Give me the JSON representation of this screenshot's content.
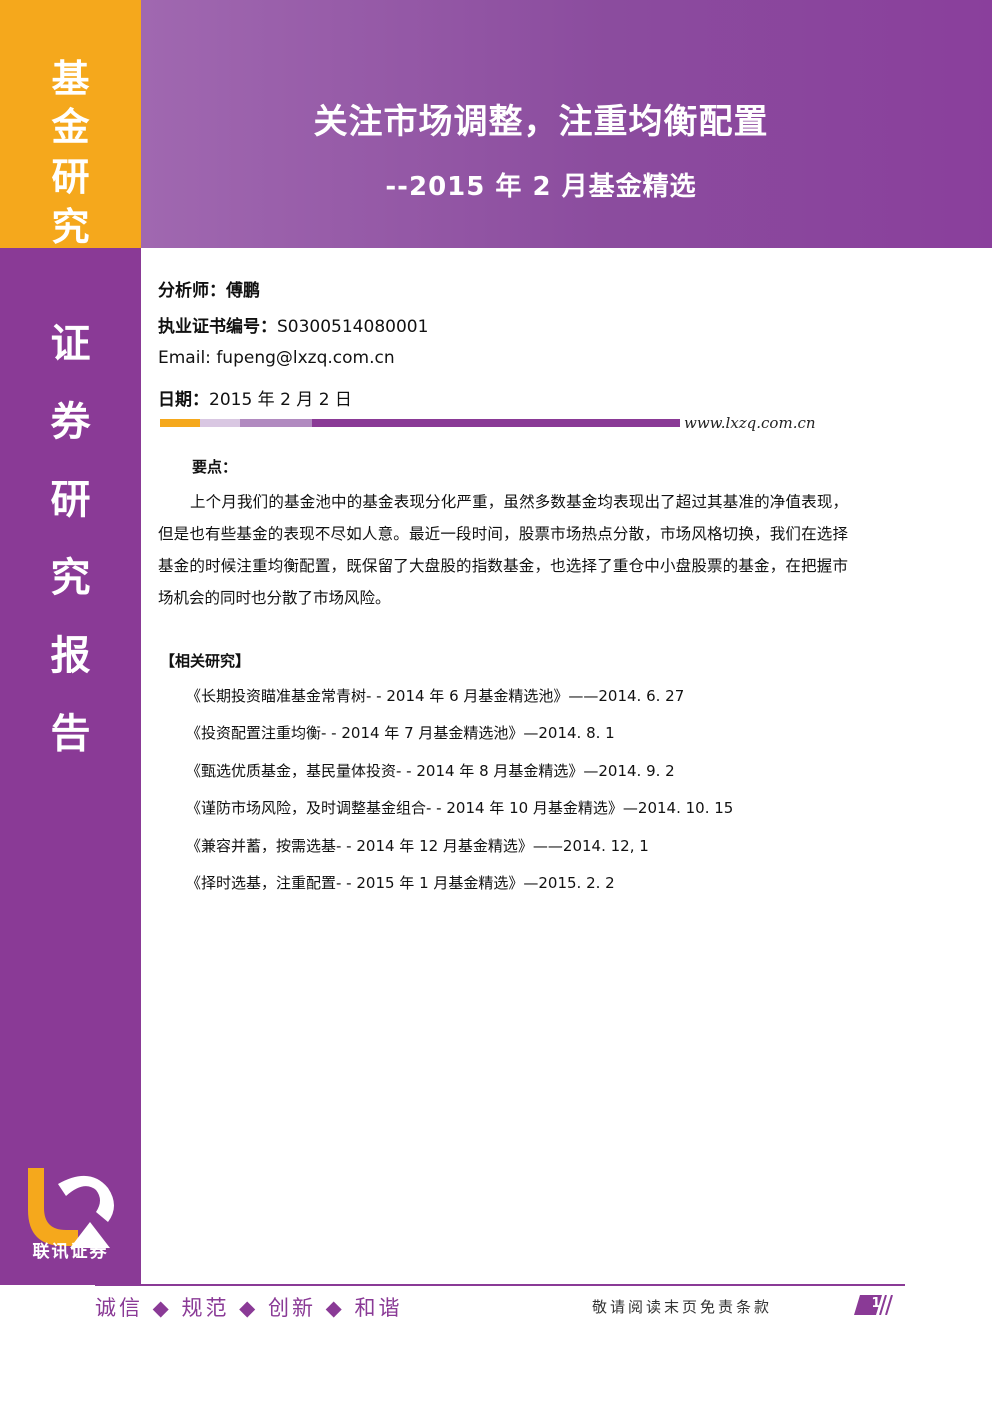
{
  "sidebar": {
    "category_chars": [
      "基",
      "金",
      "研",
      "究"
    ],
    "report_type_chars": [
      "证",
      "券",
      "研",
      "究",
      "报",
      "告"
    ],
    "logo_text": "联讯证券"
  },
  "header": {
    "title": "关注市场调整，注重均衡配置",
    "subtitle": "--2015 年 2 月基金精选"
  },
  "info": {
    "analyst_label": "分析师：",
    "analyst_name": "傅鹏",
    "cert_label": "执业证书编号：",
    "cert_number": "S0300514080001",
    "email_label": "Email:",
    "email": "fupeng@lxzq.com.cn",
    "date_label": "日期：",
    "date": "2015 年 2 月 2 日"
  },
  "website": "www.lxzq.com.cn",
  "keypoints": {
    "heading": "要点：",
    "body": "上个月我们的基金池中的基金表现分化严重，虽然多数基金均表现出了超过其基准的净值表现，但是也有些基金的表现不尽如人意。最近一段时间，股票市场热点分散，市场风格切换，我们在选择基金的时候注重均衡配置，既保留了大盘股的指数基金，也选择了重仓中小盘股票的基金，在把握市场机会的同时也分散了市场风险。"
  },
  "related": {
    "heading": "【相关研究】",
    "items": [
      "《长期投资瞄准基金常青树- - 2014 年 6 月基金精选池》——2014. 6. 27",
      "《投资配置注重均衡- - 2014 年 7 月基金精选池》—2014. 8. 1",
      "《甄选优质基金，基民量体投资- - 2014 年 8 月基金精选》—2014. 9. 2",
      "《谨防市场风险，及时调整基金组合- - 2014 年 10 月基金精选》—2014. 10. 15",
      "《兼容并蓄，按需选基- - 2014 年 12 月基金精选》——2014. 12, 1",
      "《择时选基，注重配置- - 2015 年 1 月基金精选》—2015. 2. 2"
    ]
  },
  "footer": {
    "motto": "诚信 ◆ 规范 ◆ 创新 ◆ 和谐",
    "disclaimer": "敬请阅读末页免责条款",
    "page_number": "1"
  },
  "colors": {
    "purple": "#8a3a96",
    "header_purple": "#a068b0",
    "orange": "#f5a81c"
  }
}
